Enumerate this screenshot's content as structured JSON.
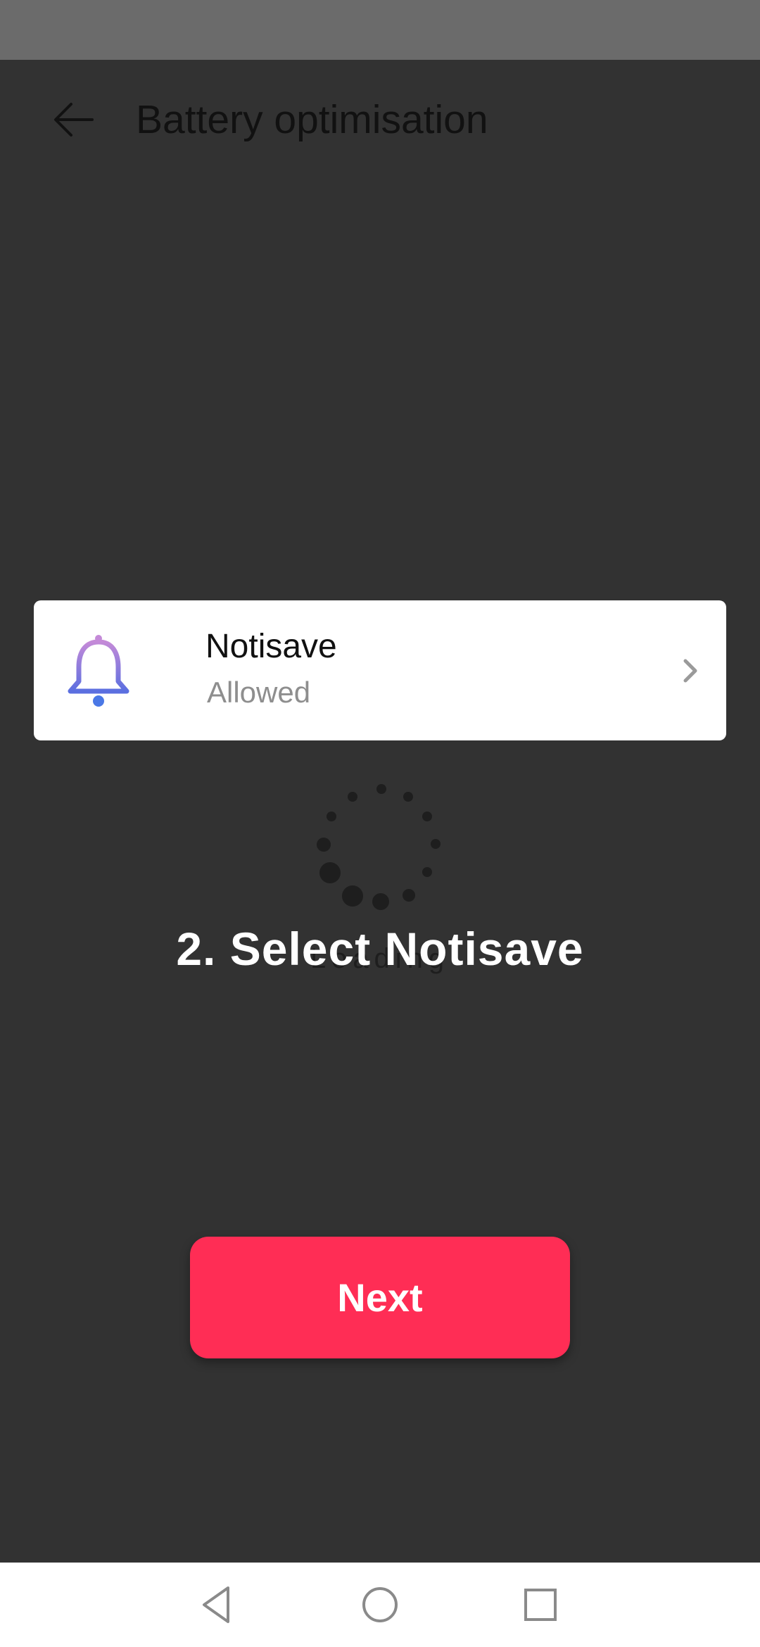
{
  "header": {
    "title": "Battery optimisation",
    "back_icon": "arrow-left-icon"
  },
  "app_item": {
    "name": "Notisave",
    "status": "Allowed",
    "icon": "bell-icon",
    "chevron_icon": "chevron-right-icon",
    "icon_colors": [
      "#c48ad8",
      "#5b6fe0"
    ]
  },
  "overlay": {
    "instruction": "2. Select Notisave",
    "loading_text": "Loading"
  },
  "next_button": {
    "label": "Next",
    "color": "#ff2d55"
  },
  "nav_bar": {
    "back_icon": "triangle-back-icon",
    "home_icon": "circle-home-icon",
    "recents_icon": "square-recents-icon"
  }
}
